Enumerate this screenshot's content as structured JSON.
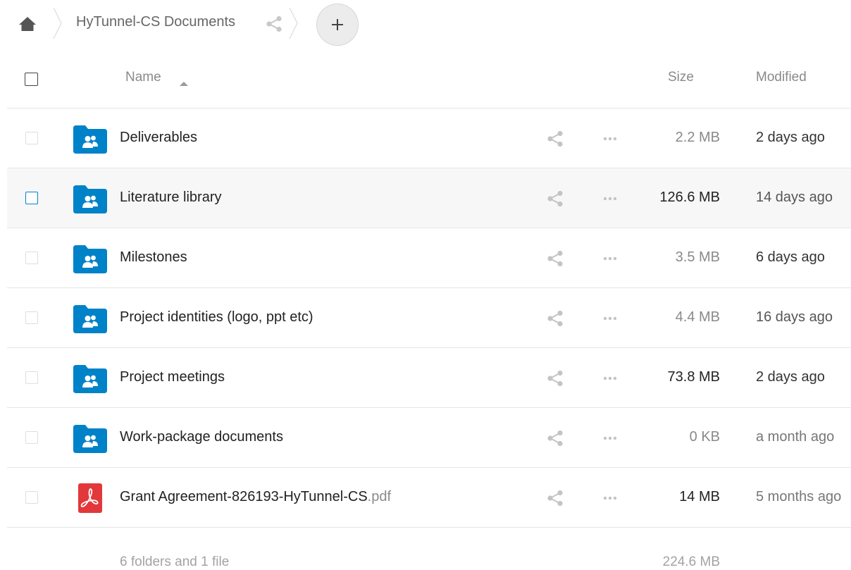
{
  "breadcrumb": {
    "title": "HyTunnel-CS Documents"
  },
  "header": {
    "name": "Name",
    "size": "Size",
    "modified": "Modified"
  },
  "files": [
    {
      "icon": "shared-folder-icon",
      "name": "Deliverables",
      "ext": "",
      "size": "2.2 MB",
      "size_color": "#8a8a8a",
      "modified": "2 days ago",
      "modified_color": "#333333"
    },
    {
      "icon": "shared-folder-icon",
      "name": "Literature library",
      "ext": "",
      "size": "126.6 MB",
      "size_color": "#222222",
      "modified": "14 days ago",
      "modified_color": "#555555"
    },
    {
      "icon": "shared-folder-icon",
      "name": "Milestones",
      "ext": "",
      "size": "3.5 MB",
      "size_color": "#8a8a8a",
      "modified": "6 days ago",
      "modified_color": "#333333"
    },
    {
      "icon": "shared-folder-icon",
      "name": "Project identities (logo, ppt etc)",
      "ext": "",
      "size": "4.4 MB",
      "size_color": "#8a8a8a",
      "modified": "16 days ago",
      "modified_color": "#555555"
    },
    {
      "icon": "shared-folder-icon",
      "name": "Project meetings",
      "ext": "",
      "size": "73.8 MB",
      "size_color": "#222222",
      "modified": "2 days ago",
      "modified_color": "#333333"
    },
    {
      "icon": "shared-folder-icon",
      "name": "Work-package documents",
      "ext": "",
      "size": "0 KB",
      "size_color": "#8a8a8a",
      "modified": "a month ago",
      "modified_color": "#777777"
    },
    {
      "icon": "pdf-icon",
      "name": "Grant Agreement-826193-HyTunnel-CS",
      "ext": ".pdf",
      "size": "14 MB",
      "size_color": "#222222",
      "modified": "5 months ago",
      "modified_color": "#777777"
    }
  ],
  "summary": {
    "count": "6 folders and 1 file",
    "total_size": "224.6 MB"
  },
  "colors": {
    "accent": "#0082c9",
    "pdf": "#e2383a"
  }
}
